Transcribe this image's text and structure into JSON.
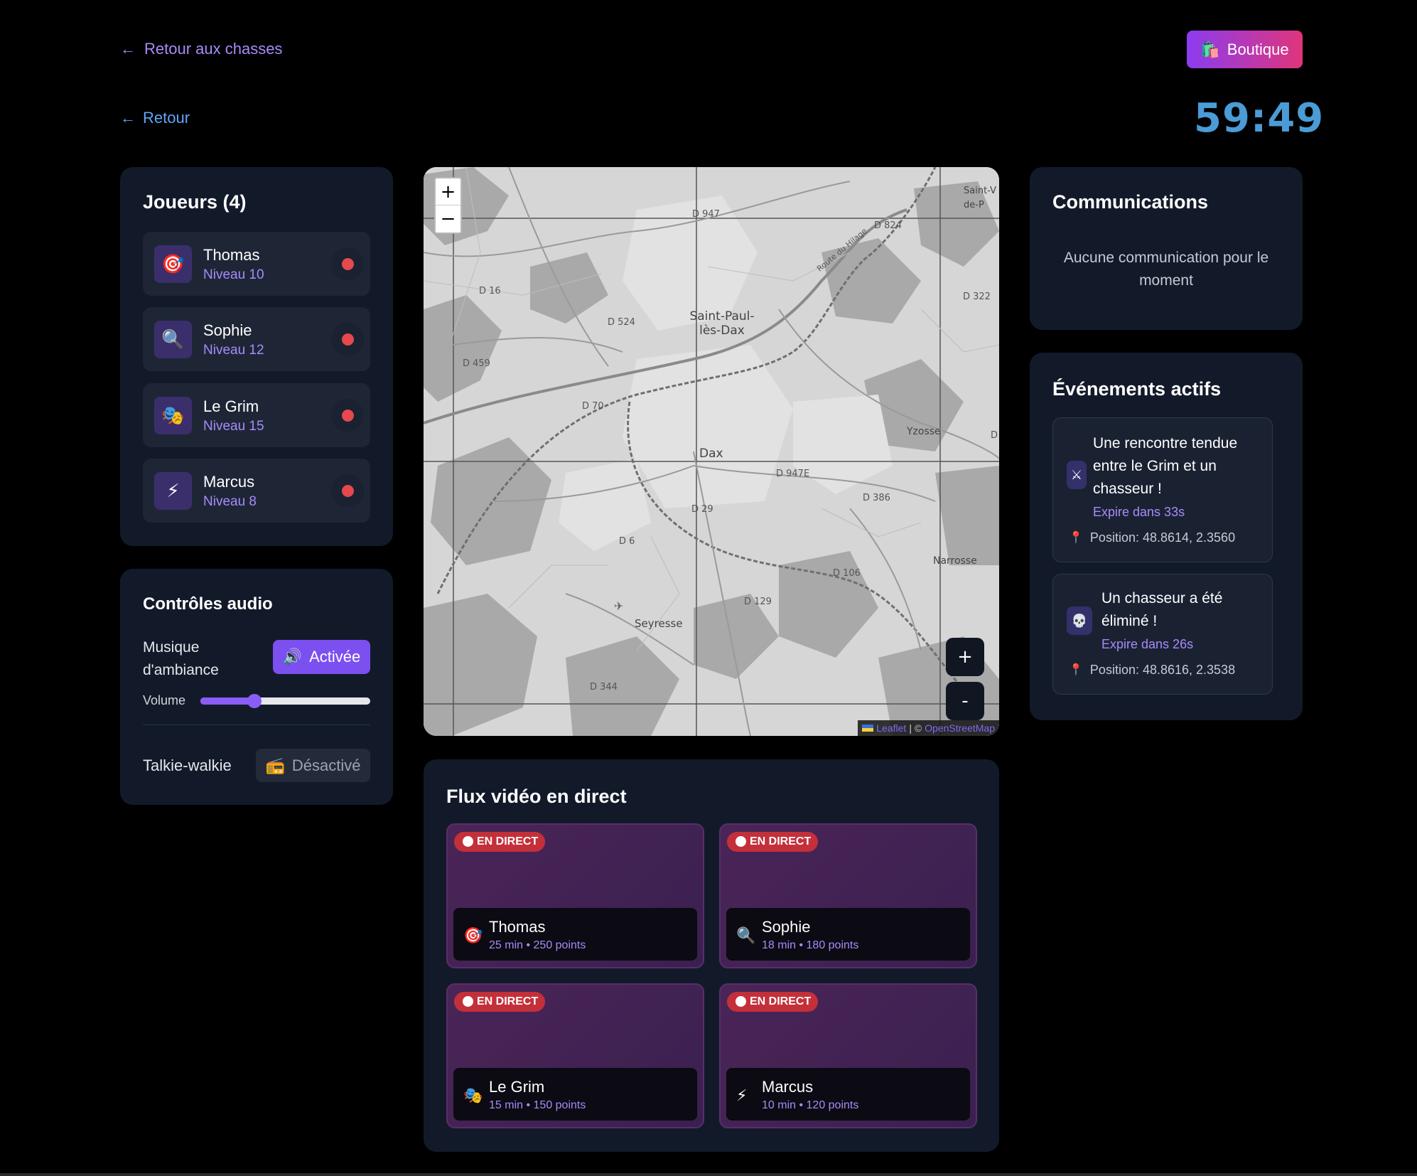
{
  "nav": {
    "back_hunts": "Retour aux chasses",
    "shop_label": "Boutique",
    "shop_icon": "shopping-bag-icon",
    "back": "Retour",
    "timer": "59:49",
    "arrow": "←"
  },
  "players": {
    "title": "Joueurs (4)",
    "items": [
      {
        "name": "Thomas",
        "level": "Niveau 10",
        "icon": "🎯"
      },
      {
        "name": "Sophie",
        "level": "Niveau 12",
        "icon": "🔍"
      },
      {
        "name": "Le Grim",
        "level": "Niveau 15",
        "icon": "🎭"
      },
      {
        "name": "Marcus",
        "level": "Niveau 8",
        "icon": "⚡"
      }
    ]
  },
  "audio": {
    "title": "Contrôles audio",
    "music_label": "Musique d'ambiance",
    "music_button": "Activée",
    "volume_label": "Volume",
    "volume_fraction": 0.32,
    "talkie_label": "Talkie-walkie",
    "talkie_button": "Désactivé"
  },
  "map": {
    "zoom_in": "+",
    "zoom_out": "−",
    "zoom_in_dark": "+",
    "zoom_out_dark": "-",
    "attribution_leaflet": "Leaflet",
    "attribution_sep": "| ©",
    "attribution_osm": "OpenStreetMap",
    "labels": [
      "D 947",
      "D 824",
      "D 16",
      "D 524",
      "D 322",
      "D 459",
      "D 70",
      "D 947E",
      "D 386",
      "D 29",
      "D 6",
      "D 106",
      "D 129",
      "D 344",
      "D"
    ],
    "cities": [
      "Saint-Paul-lès-Dax",
      "Dax",
      "Yzosse",
      "Narrosse",
      "Seyresse",
      "Saint-V de-P"
    ],
    "road_label": "Route du Hilage"
  },
  "video": {
    "title": "Flux vidéo en direct",
    "live_badge": "EN DIRECT",
    "streams": [
      {
        "name": "Thomas",
        "meta": "25 min • 250 points",
        "icon": "🎯"
      },
      {
        "name": "Sophie",
        "meta": "18 min • 180 points",
        "icon": "🔍"
      },
      {
        "name": "Le Grim",
        "meta": "15 min • 150 points",
        "icon": "🎭"
      },
      {
        "name": "Marcus",
        "meta": "10 min • 120 points",
        "icon": "⚡"
      }
    ]
  },
  "communications": {
    "title": "Communications",
    "empty": "Aucune communication pour le moment"
  },
  "events": {
    "title": "Événements actifs",
    "items": [
      {
        "title": "Une rencontre tendue entre le Grim et un chasseur !",
        "expires": "Expire dans 33s",
        "position": "Position: 48.8614, 2.3560",
        "icon": "⚔"
      },
      {
        "title": "Un chasseur a été éliminé !",
        "expires": "Expire dans 26s",
        "position": "Position: 48.8616, 2.3538",
        "icon": "💀"
      }
    ]
  },
  "colors": {
    "accent": "#8b5cf6",
    "live_red": "#c4303a",
    "timer": "#4b9bd6",
    "card": "#121a2a"
  }
}
